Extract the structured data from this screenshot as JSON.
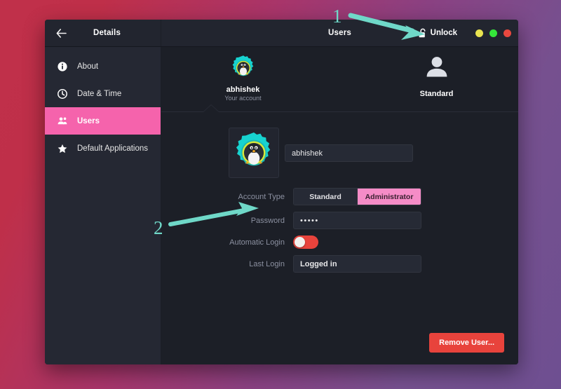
{
  "window": {
    "headerbar": {
      "back_icon": "arrow-left-icon",
      "left_title": "Details",
      "right_title": "Users",
      "unlock_label": "Unlock",
      "unlock_icon": "padlock-open-icon",
      "controls": [
        {
          "name": "minimize",
          "color": "#e9e350"
        },
        {
          "name": "maximize",
          "color": "#35e63a"
        },
        {
          "name": "close",
          "color": "#e9483f"
        }
      ]
    },
    "sidebar": {
      "items": [
        {
          "label": "About",
          "icon": "info-icon",
          "active": false
        },
        {
          "label": "Date & Time",
          "icon": "clock-icon",
          "active": false
        },
        {
          "label": "Users",
          "icon": "users-icon",
          "active": true
        },
        {
          "label": "Default Applications",
          "icon": "star-icon",
          "active": false
        }
      ],
      "active_color": "#f563ac"
    },
    "carousel": {
      "users": [
        {
          "name": "abhishek",
          "subtitle": "Your account",
          "avatar": "gear-penguin-avatar-icon",
          "selected": true
        },
        {
          "name": "Standard",
          "subtitle": "",
          "avatar": "person-avatar-icon",
          "selected": false
        }
      ]
    },
    "form": {
      "avatar_icon": "gear-penguin-avatar-icon",
      "username_value": "abhishek",
      "rows": [
        {
          "label": "Account Type",
          "type": "segmented"
        },
        {
          "label": "Password",
          "type": "password"
        },
        {
          "label": "Automatic Login",
          "type": "toggle"
        },
        {
          "label": "Last Login",
          "type": "readonly"
        }
      ],
      "account_type_options": [
        "Standard",
        "Administrator"
      ],
      "account_type_selected": "Administrator",
      "password_value": "•••••",
      "automatic_login_state": "off",
      "last_login_value": "Logged in",
      "remove_user_label": "Remove User..."
    }
  },
  "annotations": [
    {
      "number": "1",
      "target": "unlock-button",
      "color": "#6fd8c8"
    },
    {
      "number": "2",
      "target": "password-row",
      "color": "#6fd8c8"
    }
  ]
}
